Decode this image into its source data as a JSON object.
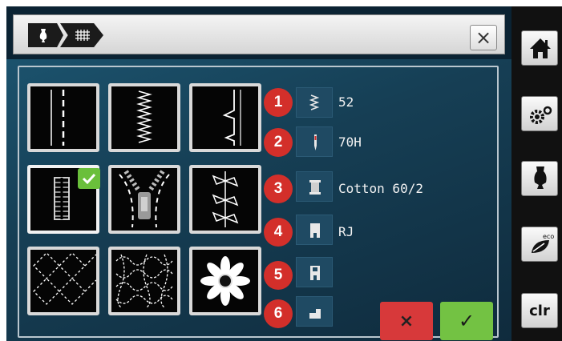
{
  "header": {
    "breadcrumb": [
      "dress-form-icon",
      "stitch-pattern-icon"
    ],
    "close_label": "×"
  },
  "stitches": [
    [
      "straight-stitch-icon",
      "zigzag-stitch-icon",
      "blind-hem-stitch-icon"
    ],
    [
      "buttonhole-stitch-icon",
      "zipper-icon",
      "decorative-leaf-stitch-icon"
    ],
    [
      "quilt-grid-stitch-icon",
      "stipple-stitch-icon",
      "flower-embroidery-icon"
    ]
  ],
  "params": [
    {
      "number": "1",
      "icon": "stitch-length-icon",
      "value": "52"
    },
    {
      "number": "2",
      "icon": "needle-icon",
      "value": "70H"
    },
    {
      "number": "3",
      "icon": "thread-spool-icon",
      "value": "Cotton 60/2"
    },
    {
      "number": "4",
      "icon": "presser-foot-icon",
      "value": "RJ"
    },
    {
      "number": "5",
      "icon": "presser-foot-alt-icon",
      "value": ""
    },
    {
      "number": "6",
      "icon": "stabilizer-icon",
      "value": ""
    }
  ],
  "actions": {
    "cancel_label": "×",
    "confirm_label": "✓"
  },
  "sidebar": {
    "buttons": [
      "home-icon",
      "settings-icon",
      "dress-form-icon",
      "eco-icon"
    ],
    "clr_label": "clr"
  },
  "colors": {
    "badge": "#d32f2a",
    "cancel": "#d7393a",
    "confirm": "#73c243",
    "selected_check": "#6abf3b"
  }
}
